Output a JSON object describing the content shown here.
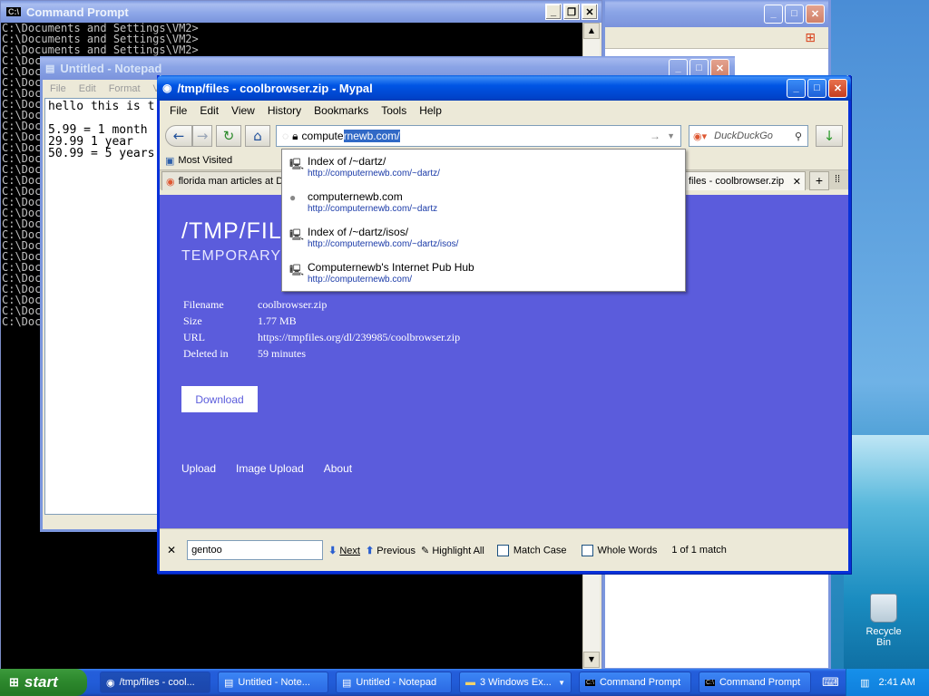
{
  "cmd": {
    "title": "Command Prompt",
    "lines": [
      "C:\\Documents and Settings\\VM2>",
      "C:\\Documents and Settings\\VM2>",
      "C:\\Documents and Settings\\VM2>",
      "C:\\Doc",
      "C:\\Doc",
      "C:\\Doc",
      "C:\\Doc",
      "C:\\Doc",
      "C:\\Doc",
      "C:\\Doc",
      "C:\\Doc",
      "C:\\Doc",
      "C:\\Doc",
      "C:\\Doc",
      "C:\\Doc",
      "C:\\Doc",
      "C:\\Doc",
      "C:\\Doc",
      "C:\\Doc",
      "C:\\Doc",
      "C:\\Doc",
      "C:\\Doc",
      "C:\\Doc",
      "C:\\Doc",
      "C:\\Doc",
      "C:\\Doc",
      "C:\\Doc",
      "C:\\Doc"
    ]
  },
  "notepad": {
    "title": "Untitled - Notepad",
    "menu": [
      "File",
      "Edit",
      "Format",
      "Vie"
    ],
    "text": "hello this is t\n\n5.99 = 1 month\n29.99 1 year\n50.99 = 5 years"
  },
  "browser": {
    "title": "/tmp/files - coolbrowser.zip - Mypal",
    "menu": [
      "File",
      "Edit",
      "View",
      "History",
      "Bookmarks",
      "Tools",
      "Help"
    ],
    "url_typed": "compute",
    "url_autocomplete": "rnewb.com/",
    "search_placeholder": "DuckDuckGo",
    "bookmarks_item": "Most Visited",
    "tabs": [
      {
        "label": "florida man articles at D"
      },
      {
        "label": "files - coolbrowser.zip"
      }
    ],
    "dropdown": [
      {
        "title": "Index of /~dartz/",
        "url": "http://computernewb.com/~dartz/",
        "icon": "server-icon"
      },
      {
        "title": "computernewb.com",
        "url": "http://computernewb.com/~dartz",
        "icon": "globe-icon"
      },
      {
        "title": "Index of /~dartz/isos/",
        "url": "http://computernewb.com/~dartz/isos/",
        "icon": "server-icon"
      },
      {
        "title": "Computernewb's Internet Pub Hub",
        "url": "http://computernewb.com/",
        "icon": "server-icon"
      }
    ],
    "page": {
      "heading": "/TMP/FILE",
      "subheading": "TEMPORARY F",
      "info": [
        {
          "key": "Filename",
          "value": "coolbrowser.zip"
        },
        {
          "key": "Size",
          "value": "1.77 MB"
        },
        {
          "key": "URL",
          "value": "https://tmpfiles.org/dl/239985/coolbrowser.zip"
        },
        {
          "key": "Deleted in",
          "value": "59 minutes"
        }
      ],
      "download_label": "Download",
      "footer_links": [
        "Upload",
        "Image Upload",
        "About"
      ],
      "background": "#5b5cdc"
    },
    "find": {
      "value": "gentoo",
      "next": "Next",
      "previous": "Previous",
      "highlight": "Highlight All",
      "match_case": "Match Case",
      "whole_words": "Whole Words",
      "status": "1 of 1 match"
    }
  },
  "desktop": {
    "recycle_bin": "Recycle Bin"
  },
  "taskbar": {
    "start": "start",
    "items": [
      {
        "label": "/tmp/files - cool...",
        "active": true
      },
      {
        "label": "Untitled - Note..."
      },
      {
        "label": "Untitled - Notepad"
      },
      {
        "label": "3 Windows Ex..."
      },
      {
        "label": "Command Prompt"
      },
      {
        "label": "Command Prompt"
      }
    ],
    "clock": "2:41 AM"
  }
}
